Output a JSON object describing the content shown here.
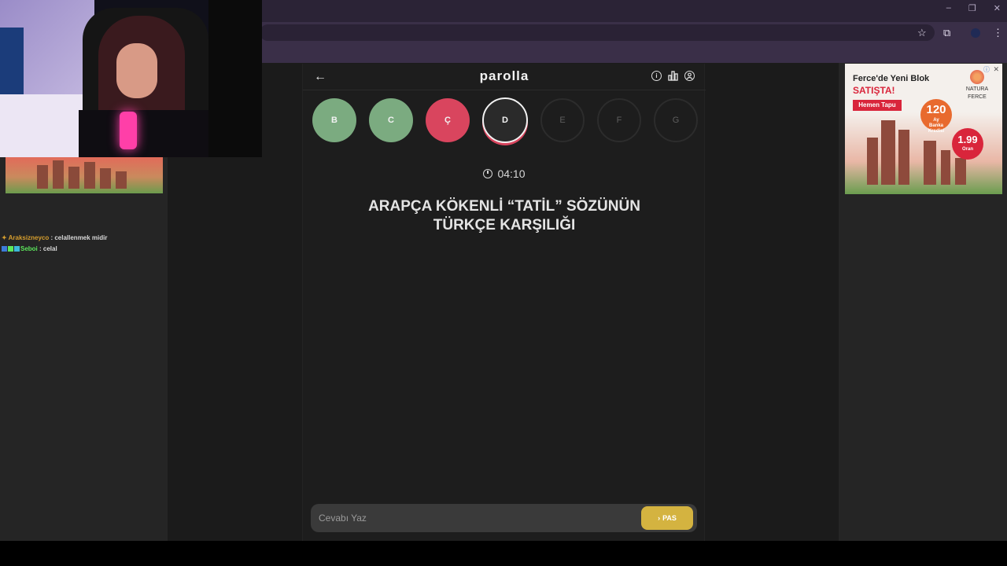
{
  "browser": {
    "window_controls": [
      "–",
      "❐",
      "✕"
    ],
    "toolbar_icons": [
      "star-icon",
      "extensions-icon",
      "profile-icon",
      "menu-icon"
    ]
  },
  "stream": {
    "chat": [
      {
        "user": "Araksizneyco",
        "message": "celallenmek midir"
      },
      {
        "user": "Seboi",
        "message": "celal"
      }
    ]
  },
  "game": {
    "brand": "parolla",
    "letters": [
      {
        "label": "B",
        "state": "correct"
      },
      {
        "label": "C",
        "state": "correct"
      },
      {
        "label": "Ç",
        "state": "wrong"
      },
      {
        "label": "D",
        "state": "active"
      },
      {
        "label": "E",
        "state": "pending"
      },
      {
        "label": "F",
        "state": "pending"
      },
      {
        "label": "G",
        "state": "pending"
      }
    ],
    "timer": "04:10",
    "question_line1": "ARAPÇA KÖKENLİ “TATİL” SÖZÜNÜN",
    "question_line2": "TÜRKÇE KARŞILIĞI",
    "answer_placeholder": "Cevabı Yaz",
    "answer_value": "",
    "pass_label": "PAS"
  },
  "ad": {
    "title": "Ferce'de Yeni Blok",
    "headline": "SATIŞTA!",
    "cta": "Hemen Tapu",
    "brand": "NATURA",
    "brand_sub": "FERCE",
    "months": "120",
    "months_unit": "Ay",
    "months_sub": "Banka Kredisi",
    "rate": "1.99",
    "rate_sub": "Oran"
  },
  "colors": {
    "correct": "#7bab80",
    "wrong": "#d9455e",
    "pass_button": "#d4b340",
    "panel_bg": "#1d1d1d"
  }
}
